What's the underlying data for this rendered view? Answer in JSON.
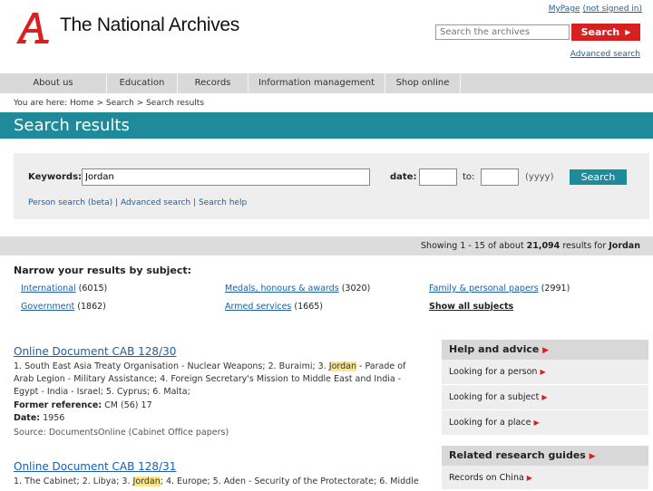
{
  "header": {
    "logo_text": "The National Archives",
    "mypage_link": "MyPage",
    "mypage_status": "(not signed in)",
    "search_placeholder": "Search the archives",
    "search_button": "Search",
    "advanced_search": "Advanced search"
  },
  "nav": {
    "items": [
      "About us",
      "Education",
      "Records",
      "Information management",
      "Shop online"
    ]
  },
  "breadcrumb": {
    "prefix": "You are here:",
    "items": [
      "Home",
      "Search",
      "Search results"
    ]
  },
  "page_title": "Search results",
  "search_form": {
    "keywords_label": "Keywords:",
    "keywords_value": "Jordan",
    "date_label": "date:",
    "to_label": "to:",
    "yyyy_hint": "(yyyy)",
    "search_button": "Search",
    "links": [
      "Person search (beta)",
      "Advanced search",
      "Search help"
    ]
  },
  "results_summary": {
    "showing": "Showing 1 - 15 of about",
    "count": "21,094",
    "for": "results for",
    "query": "Jordan"
  },
  "narrow": {
    "title": "Narrow your results by subject:",
    "subjects": [
      {
        "label": "International",
        "count": "(6015)"
      },
      {
        "label": "Medals, honours & awards",
        "count": "(3020)"
      },
      {
        "label": "Family & personal papers",
        "count": "(2991)"
      },
      {
        "label": "Government",
        "count": "(1862)"
      },
      {
        "label": "Armed services",
        "count": "(1665)"
      }
    ],
    "show_all": "Show all subjects"
  },
  "results": [
    {
      "title": "Online Document CAB 128/30",
      "desc_a": "1. South East Asia Treaty Organisation - Nuclear Weapons; 2. Buraimi; 3. ",
      "desc_hl": "Jordan",
      "desc_b": " - Parade of Arab Legion - Military Assistance; 4. Foreign Secretary's Mission to Middle East and India - Egypt - India - Israel; 5. Cyprus; 6. Malta;",
      "former_label": "Former reference:",
      "former_value": "CM (56) 17",
      "date_label": "Date:",
      "date_value": "1956",
      "source": "Source: DocumentsOnline (Cabinet Office papers)"
    },
    {
      "title": "Online Document CAB 128/31",
      "desc_a": "1. The Cabinet; 2. Libya; 3. ",
      "desc_hl": "Jordan",
      "desc_b": "; 4. Europe; 5. Aden - Security of the Protectorate; 6. Middle"
    }
  ],
  "sidebar": {
    "help_title": "Help and advice",
    "help_items": [
      "Looking for a person",
      "Looking for a subject",
      "Looking for a place"
    ],
    "guides_title": "Related research guides",
    "guides_items": [
      "Records on China"
    ]
  },
  "colors": {
    "brand_red": "#d72121",
    "teal": "#1e8a9a",
    "link_blue": "#1a5fa8",
    "highlight": "#ffe58a"
  }
}
